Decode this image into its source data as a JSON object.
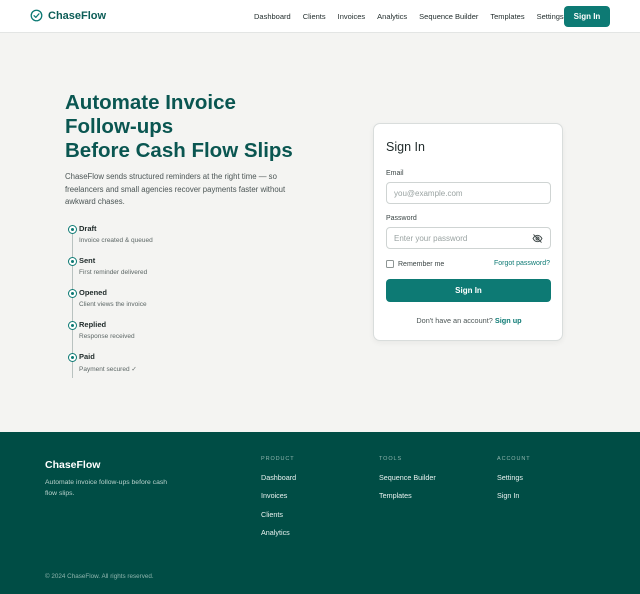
{
  "header": {
    "brand": "ChaseFlow",
    "nav": [
      "Dashboard",
      "Clients",
      "Invoices",
      "Analytics",
      "Sequence Builder",
      "Templates",
      "Settings"
    ],
    "signin_label": "Sign In"
  },
  "hero": {
    "title_lines": [
      "Automate Invoice",
      "Follow-ups",
      "Before Cash Flow Slips"
    ],
    "description": "ChaseFlow sends structured reminders at the right time — so freelancers and small agencies recover payments faster without awkward chases.",
    "steps": [
      {
        "title": "Draft",
        "desc": "Invoice created & queued"
      },
      {
        "title": "Sent",
        "desc": "First reminder delivered"
      },
      {
        "title": "Opened",
        "desc": "Client views the invoice"
      },
      {
        "title": "Replied",
        "desc": "Response received"
      },
      {
        "title": "Paid",
        "desc": "Payment secured ✓"
      }
    ]
  },
  "signin_card": {
    "title": "Sign In",
    "email_label": "Email",
    "email_placeholder": "you@example.com",
    "password_label": "Password",
    "password_placeholder": "Enter your password",
    "remember_label": "Remember me",
    "forgot_label": "Forgot password?",
    "submit_label": "Sign In",
    "signup_prompt": "Don't have an account?",
    "signup_link": "Sign up"
  },
  "footer": {
    "brand": "ChaseFlow",
    "tagline": "Automate invoice follow-ups before cash flow slips.",
    "columns": [
      {
        "heading": "PRODUCT",
        "links": [
          "Dashboard",
          "Invoices",
          "Clients",
          "Analytics"
        ]
      },
      {
        "heading": "TOOLS",
        "links": [
          "Sequence Builder",
          "Templates"
        ]
      },
      {
        "heading": "ACCOUNT",
        "links": [
          "Settings",
          "Sign In"
        ]
      }
    ],
    "copyright": "© 2024 ChaseFlow. All rights reserved."
  },
  "colors": {
    "brand": "#0d7a74",
    "footer_bg": "#004d45",
    "title": "#0a5651"
  },
  "icons": {
    "brand": "check-circle-icon",
    "password_toggle": "eye-off-icon"
  }
}
